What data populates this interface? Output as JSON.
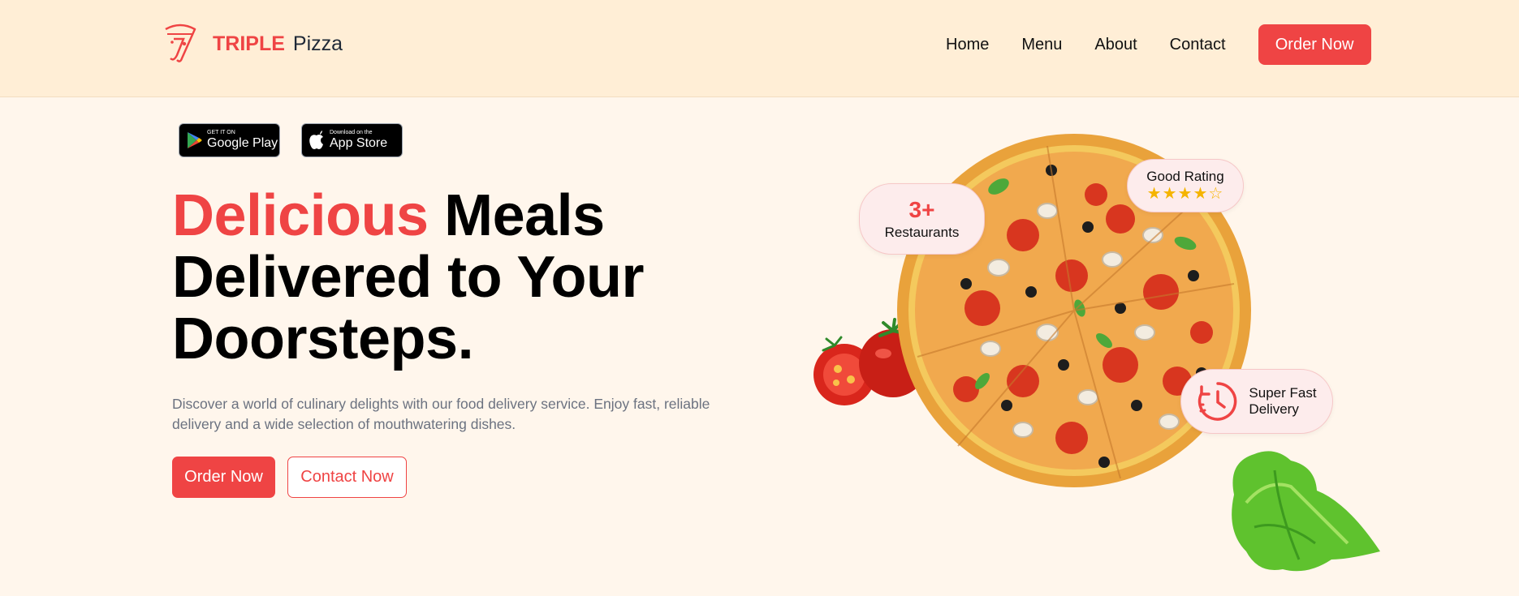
{
  "header": {
    "brand_primary": "TRIPLE",
    "brand_secondary": "Pizza",
    "nav": [
      "Home",
      "Menu",
      "About",
      "Contact"
    ],
    "order_button": "Order Now"
  },
  "stores": {
    "google": {
      "small": "GET IT ON",
      "large": "Google Play"
    },
    "apple": {
      "small": "Download on the",
      "large": "App Store"
    }
  },
  "hero": {
    "title_highlight": "Delicious",
    "title_line1_rest": " Meals",
    "title_line2": "Delivered to Your",
    "title_line3": "Doorsteps.",
    "description": "Discover a world of culinary delights with our food delivery service. Enjoy fast, reliable delivery and a wide selection of mouthwatering dishes.",
    "order_button": "Order Now",
    "contact_button": "Contact Now"
  },
  "badges": {
    "restaurants": {
      "value": "3+",
      "label": "Restaurants"
    },
    "rating": {
      "label": "Good Rating",
      "stars": "★★★★☆",
      "score": 4,
      "max": 5
    },
    "delivery": {
      "label_line1": "Super Fast",
      "label_line2": "Delivery"
    }
  },
  "colors": {
    "accent": "#ef4444",
    "background": "#fff6ec",
    "header": "#ffeed6",
    "star": "#f5b400"
  }
}
